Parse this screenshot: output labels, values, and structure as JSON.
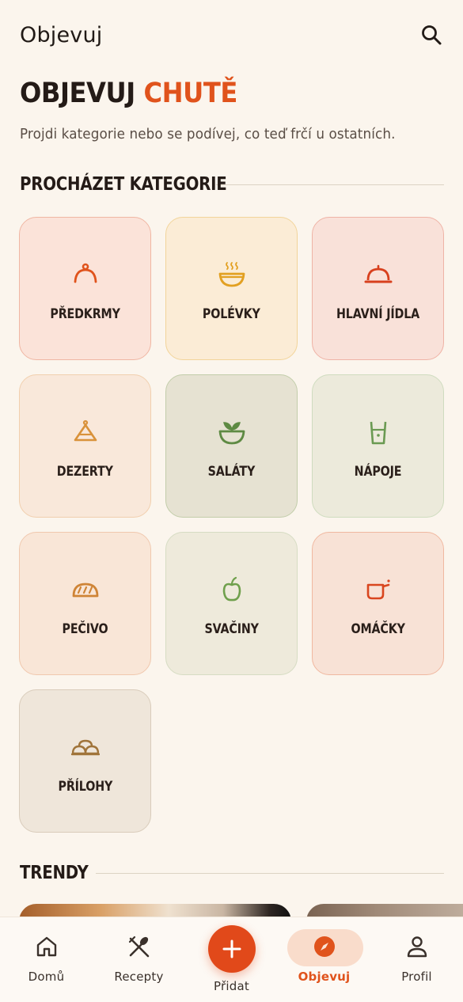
{
  "header": {
    "title": "Objevuj",
    "search_icon": "search-icon"
  },
  "hero": {
    "title_dark": "OBJEVUJ",
    "title_accent": "CHUTĚ",
    "subtitle": "Projdi kategorie nebo se podívej, co teď frčí u ostatních."
  },
  "sections": {
    "categories": "PROCHÁZET KATEGORIE",
    "trends": "TRENDY"
  },
  "categories": [
    {
      "label": "PŘEDKRMY",
      "icon": "cloche-small-icon",
      "bg": "#fbe3d9",
      "border": "#f0b6a3",
      "color": "#e0531c"
    },
    {
      "label": "POLÉVKY",
      "icon": "soup-bowl-icon",
      "bg": "#fbecd6",
      "border": "#f2d49a",
      "color": "#e2a021"
    },
    {
      "label": "HLAVNÍ JÍDLA",
      "icon": "cloche-icon",
      "bg": "#f9e1d9",
      "border": "#efb3a6",
      "color": "#d8401e"
    },
    {
      "label": "DEZERTY",
      "icon": "cake-icon",
      "bg": "#f9e8da",
      "border": "#f1cfae",
      "color": "#d9923a"
    },
    {
      "label": "SALÁTY",
      "icon": "salad-bowl-icon",
      "bg": "#e6e2d2",
      "border": "#c2cdaa",
      "color": "#5e8a43"
    },
    {
      "label": "NÁPOJE",
      "icon": "drink-glass-icon",
      "bg": "#eceadb",
      "border": "#cfdcbf",
      "color": "#6a9a52"
    },
    {
      "label": "PEČIVO",
      "icon": "bread-icon",
      "bg": "#f9e6d7",
      "border": "#f0c8ae",
      "color": "#cf8436"
    },
    {
      "label": "SVAČINY",
      "icon": "apple-icon",
      "bg": "#eeeadb",
      "border": "#d6dcc3",
      "color": "#6fa04c"
    },
    {
      "label": "OMÁČKY",
      "icon": "sauce-pan-icon",
      "bg": "#f8e2d6",
      "border": "#f0b8a0",
      "color": "#d9461f"
    },
    {
      "label": "PŘÍLOHY",
      "icon": "dumplings-icon",
      "bg": "#efe6da",
      "border": "#d9ccbb",
      "color": "#a0743a"
    }
  ],
  "nav": [
    {
      "label": "Domů",
      "icon": "home-icon"
    },
    {
      "label": "Recepty",
      "icon": "utensils-icon"
    },
    {
      "label": "Přidat",
      "icon": "plus-icon"
    },
    {
      "label": "Objevuj",
      "icon": "compass-icon",
      "active": true
    },
    {
      "label": "Profil",
      "icon": "user-icon"
    }
  ],
  "colors": {
    "accent": "#e0531c",
    "background": "#fbf5ed"
  }
}
